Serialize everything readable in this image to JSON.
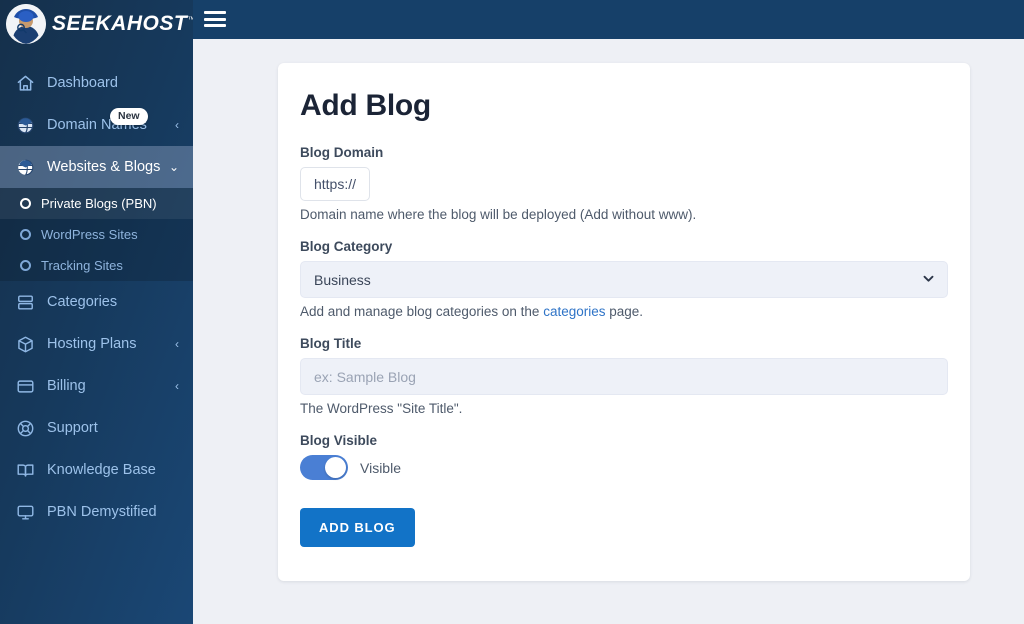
{
  "brand": {
    "name": "SEEKAHOST",
    "tm": "™",
    "logo_icon": "detective-avatar-icon"
  },
  "topbar": {
    "menu_toggle_icon": "hamburger-menu-icon",
    "background": "#164069"
  },
  "sidebar": {
    "background_from": "#15304b",
    "background_to": "#1a4775",
    "items": [
      {
        "label": "Dashboard",
        "icon": "home-icon",
        "caret": "",
        "badge": "",
        "active": false
      },
      {
        "label": "Domain Names",
        "icon": "globe-icon",
        "caret": "‹",
        "badge": "New",
        "active": false
      },
      {
        "label": "Websites & Blogs",
        "icon": "globe-icon",
        "caret": "⌄",
        "badge": "",
        "active": true
      },
      {
        "label": "Categories",
        "icon": "server-icon",
        "caret": "",
        "badge": "",
        "active": false
      },
      {
        "label": "Hosting Plans",
        "icon": "box-icon",
        "caret": "‹",
        "badge": "",
        "active": false
      },
      {
        "label": "Billing",
        "icon": "credit-card-icon",
        "caret": "‹",
        "badge": "",
        "active": false
      },
      {
        "label": "Support",
        "icon": "lifebuoy-icon",
        "caret": "",
        "badge": "",
        "active": false
      },
      {
        "label": "Knowledge Base",
        "icon": "book-icon",
        "caret": "",
        "badge": "",
        "active": false
      },
      {
        "label": "PBN Demystified",
        "icon": "monitor-icon",
        "caret": "",
        "badge": "",
        "active": false
      }
    ],
    "subitems": [
      {
        "label": "Private Blogs (PBN)",
        "icon": "circle-icon",
        "active": true
      },
      {
        "label": "WordPress Sites",
        "icon": "circle-icon",
        "active": false
      },
      {
        "label": "Tracking Sites",
        "icon": "circle-icon",
        "active": false
      }
    ]
  },
  "main": {
    "page_title": "Add Blog",
    "fields": {
      "domain": {
        "label": "Blog Domain",
        "prefix": "https://",
        "help": "Domain name where the blog will be deployed (Add without www)."
      },
      "category": {
        "label": "Blog Category",
        "selected": "Business",
        "chevron_icon": "chevron-down-icon",
        "help_before": "Add and manage blog categories on the ",
        "help_link": "categories",
        "help_after": " page."
      },
      "title": {
        "label": "Blog Title",
        "value": "",
        "placeholder": "ex: Sample Blog",
        "help": "The WordPress \"Site Title\"."
      },
      "visible": {
        "label": "Blog Visible",
        "toggle_state": "on",
        "toggle_text": "Visible"
      }
    },
    "submit_label": "ADD BLOG",
    "accent_color": "#1273c7"
  }
}
